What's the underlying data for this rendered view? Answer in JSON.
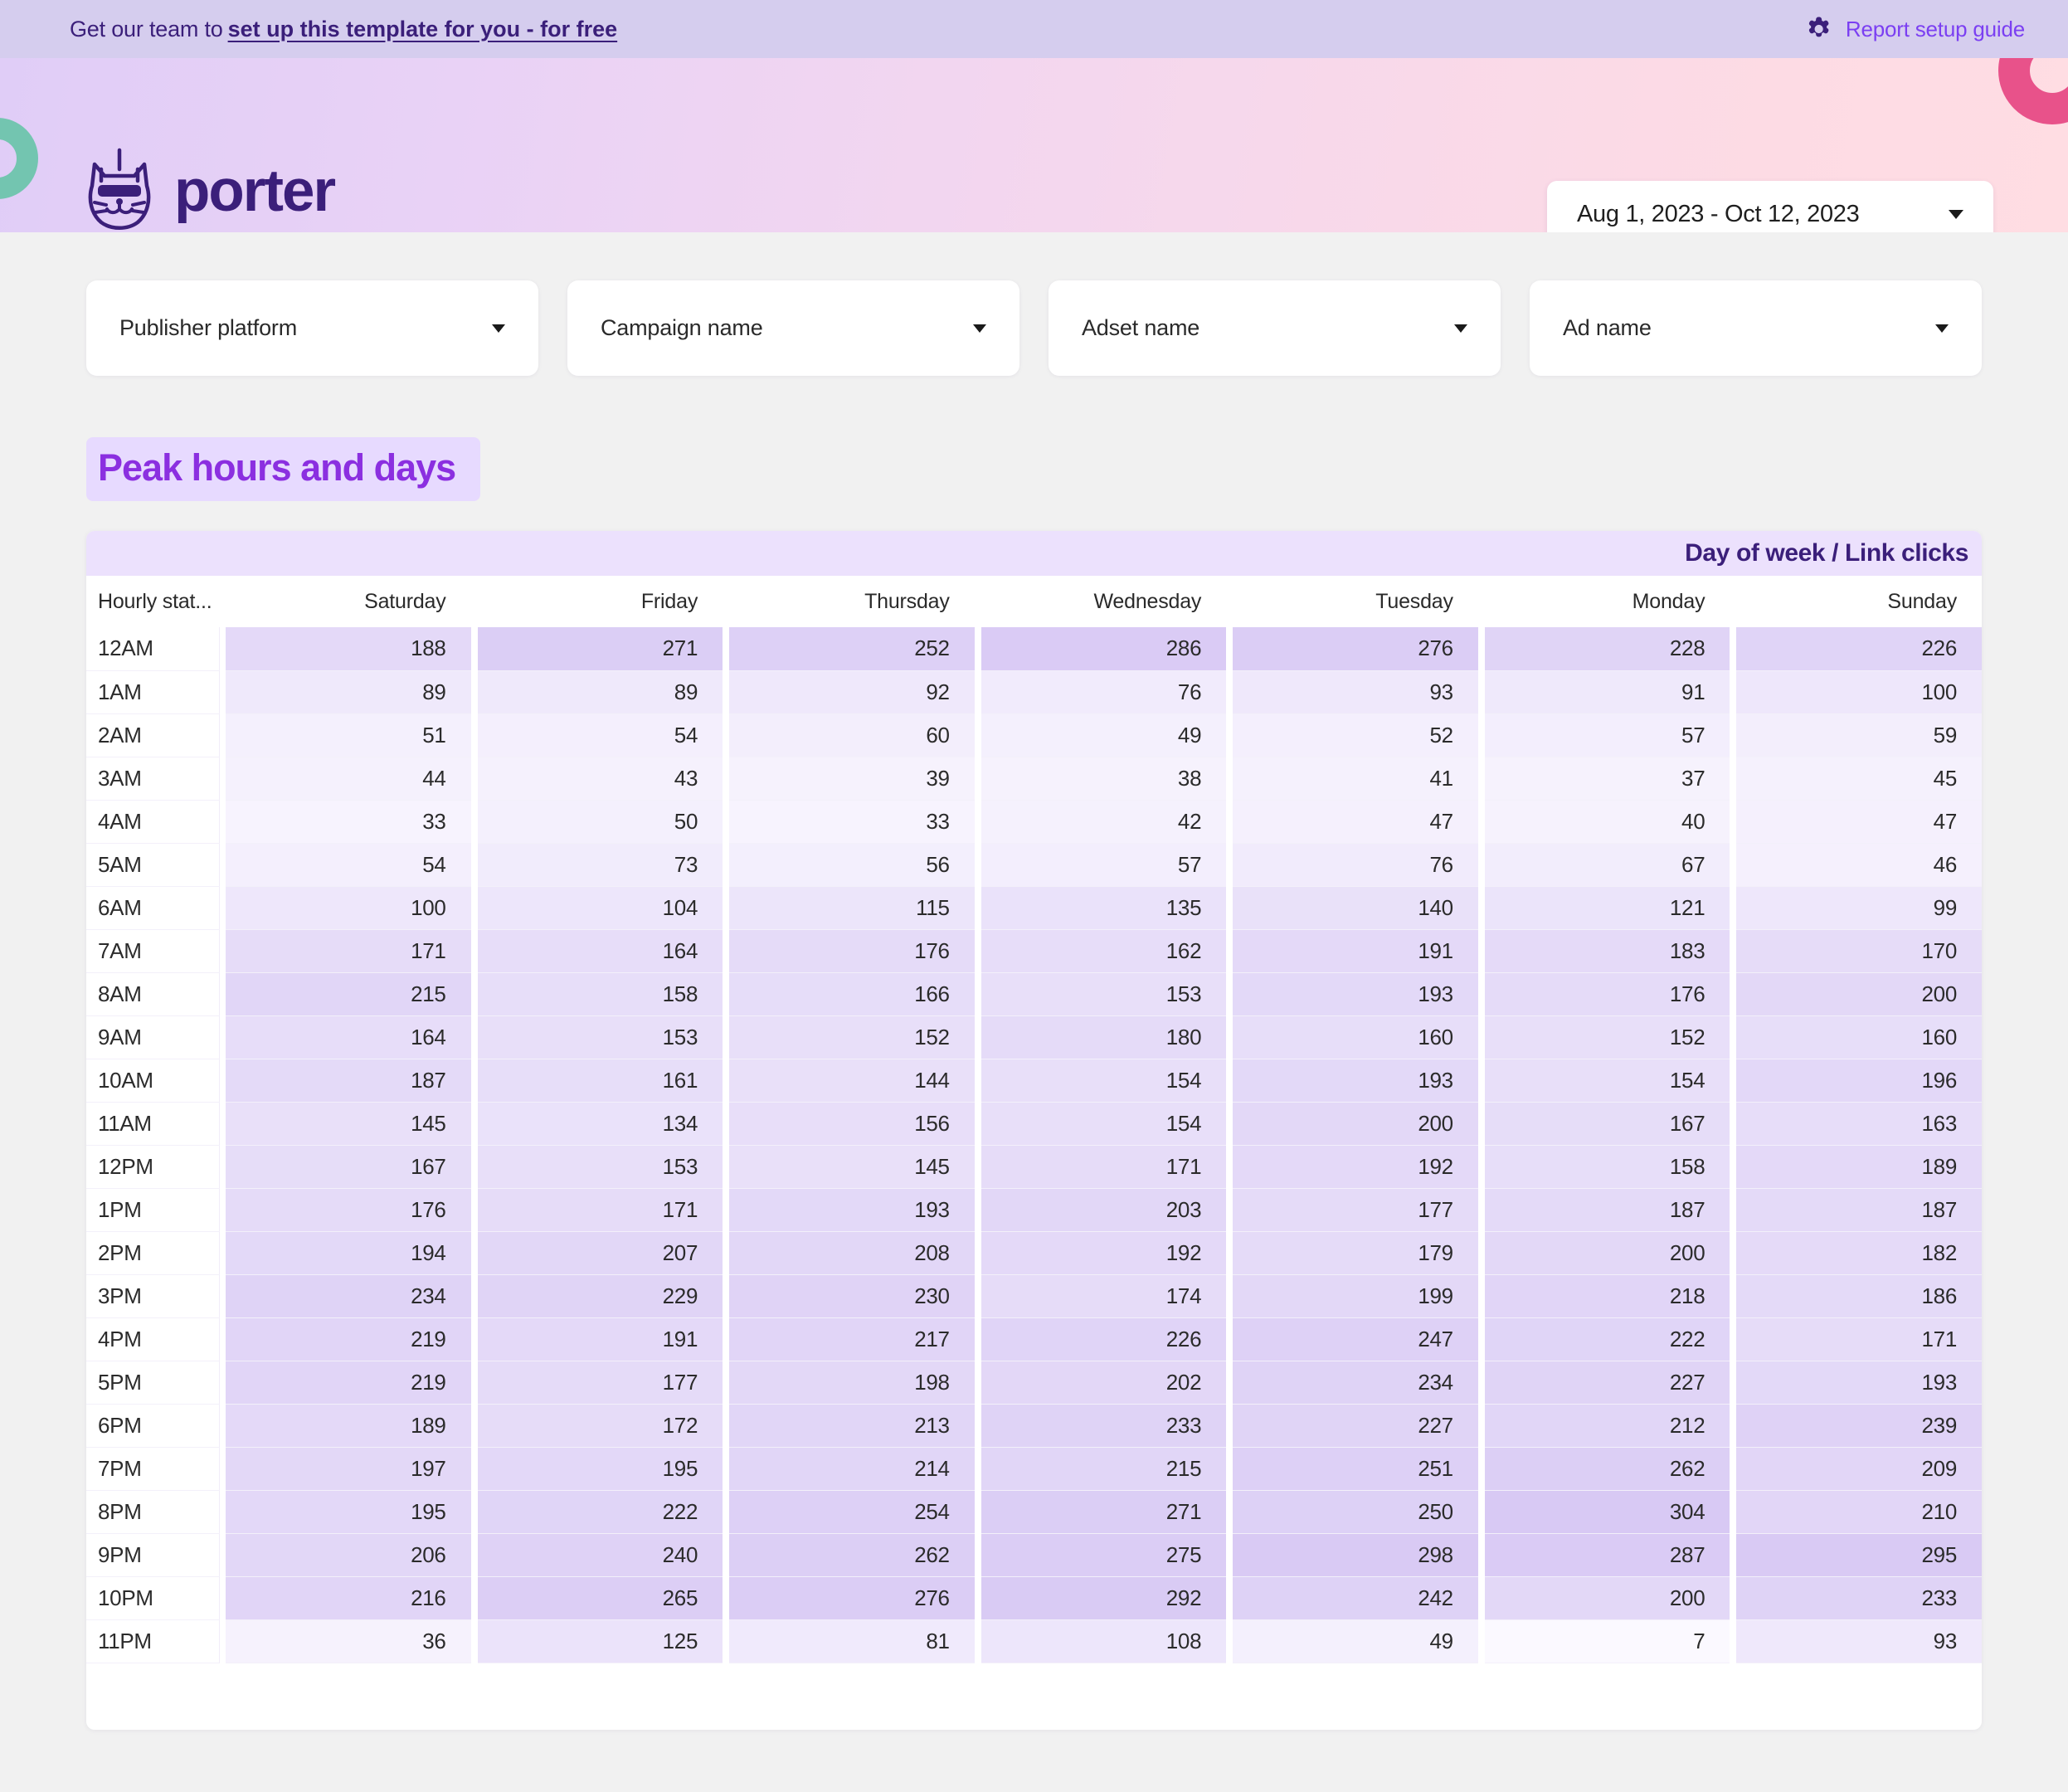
{
  "promo": {
    "text": "Get our team to",
    "link_label": "set up this template for you - for free",
    "setup_guide_label": "Report setup guide",
    "gear_icon": "gear-icon"
  },
  "brand": {
    "name": "porter",
    "logo_icon": "porter-cat-logo-icon",
    "accent_purple": "#3b1f7a",
    "accent_violet": "#7b3ff2",
    "deco_teal": "#73c5b0",
    "deco_pink": "#e8528a"
  },
  "date_picker": {
    "value": "Aug 1, 2023 - Oct 12, 2023",
    "caret_icon": "chevron-down-icon"
  },
  "filters": [
    {
      "label": "Publisher platform",
      "caret_icon": "chevron-down-icon"
    },
    {
      "label": "Campaign name",
      "caret_icon": "chevron-down-icon"
    },
    {
      "label": "Adset name",
      "caret_icon": "chevron-down-icon"
    },
    {
      "label": "Ad name",
      "caret_icon": "chevron-down-icon"
    }
  ],
  "section": {
    "title": "Peak hours and days"
  },
  "table": {
    "band_title": "Day of week / Link clicks",
    "row_header_label": "Hourly stat..."
  },
  "chart_data": {
    "type": "heatmap",
    "title": "Peak hours and days",
    "xlabel": "Day of week",
    "ylabel": "Hourly stat...",
    "metric": "Link clicks",
    "categories": [
      "Saturday",
      "Friday",
      "Thursday",
      "Wednesday",
      "Tuesday",
      "Monday",
      "Sunday"
    ],
    "rows": [
      "12AM",
      "1AM",
      "2AM",
      "3AM",
      "4AM",
      "5AM",
      "6AM",
      "7AM",
      "8AM",
      "9AM",
      "10AM",
      "11AM",
      "12PM",
      "1PM",
      "2PM",
      "3PM",
      "4PM",
      "5PM",
      "6PM",
      "7PM",
      "8PM",
      "9PM",
      "10PM",
      "11PM"
    ],
    "values": [
      [
        188,
        271,
        252,
        286,
        276,
        228,
        226
      ],
      [
        89,
        89,
        92,
        76,
        93,
        91,
        100
      ],
      [
        51,
        54,
        60,
        49,
        52,
        57,
        59
      ],
      [
        44,
        43,
        39,
        38,
        41,
        37,
        45
      ],
      [
        33,
        50,
        33,
        42,
        47,
        40,
        47
      ],
      [
        54,
        73,
        56,
        57,
        76,
        67,
        46
      ],
      [
        100,
        104,
        115,
        135,
        140,
        121,
        99
      ],
      [
        171,
        164,
        176,
        162,
        191,
        183,
        170
      ],
      [
        215,
        158,
        166,
        153,
        193,
        176,
        200
      ],
      [
        164,
        153,
        152,
        180,
        160,
        152,
        160
      ],
      [
        187,
        161,
        144,
        154,
        193,
        154,
        196
      ],
      [
        145,
        134,
        156,
        154,
        200,
        167,
        163
      ],
      [
        167,
        153,
        145,
        171,
        192,
        158,
        189
      ],
      [
        176,
        171,
        193,
        203,
        177,
        187,
        187
      ],
      [
        194,
        207,
        208,
        192,
        179,
        200,
        182
      ],
      [
        234,
        229,
        230,
        174,
        199,
        218,
        186
      ],
      [
        219,
        191,
        217,
        226,
        247,
        222,
        171
      ],
      [
        219,
        177,
        198,
        202,
        234,
        227,
        193
      ],
      [
        189,
        172,
        213,
        233,
        227,
        212,
        239
      ],
      [
        197,
        195,
        214,
        215,
        251,
        262,
        209
      ],
      [
        195,
        222,
        254,
        271,
        250,
        304,
        210
      ],
      [
        206,
        240,
        262,
        275,
        298,
        287,
        295
      ],
      [
        216,
        265,
        276,
        292,
        242,
        200,
        233
      ],
      [
        36,
        125,
        81,
        108,
        49,
        7,
        93
      ]
    ],
    "value_min": 7,
    "value_max": 304,
    "color_low": "#fbf9ff",
    "color_high": "#d8c9f4"
  }
}
